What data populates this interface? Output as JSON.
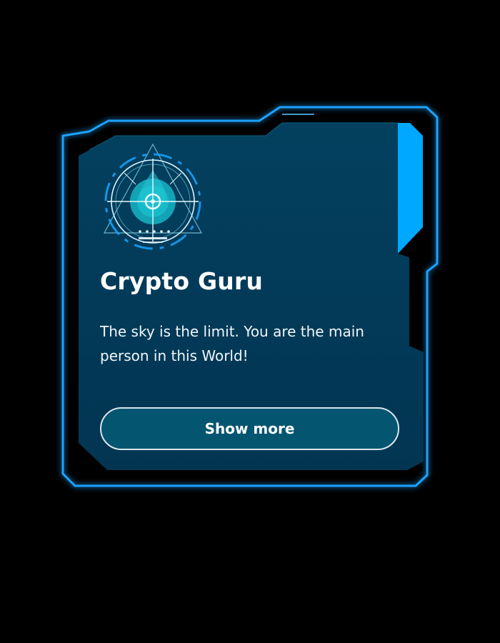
{
  "card": {
    "title": "Crypto Guru",
    "description": "The sky is the limit. You are the main person in this World!",
    "button_label": "Show more",
    "emblem_icon": "crypto-target-emblem-icon"
  },
  "colors": {
    "background": "#000000",
    "card_fill": "#033b58",
    "neon_border": "#1aa3ff",
    "accent_tab": "#00a8ff",
    "button_fill": "#045570",
    "button_border": "#d9e6ec",
    "text": "#ffffff"
  }
}
